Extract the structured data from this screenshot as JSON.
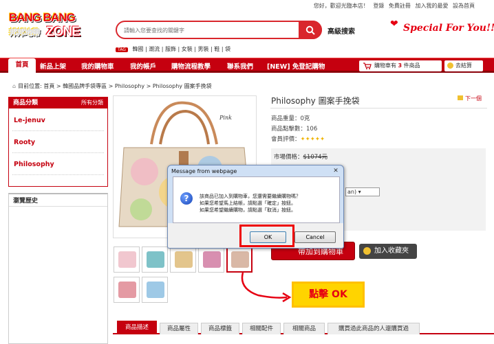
{
  "header": {
    "top_links": [
      "您好，歡迎光臨本店！",
      "登錄",
      "免費註冊",
      "加入我的最愛",
      "設為首頁"
    ],
    "logo_line1": "BANG BANG",
    "logo_line2": "ZONE",
    "logo_sub": "邦邦地帶",
    "search": {
      "placeholder": "請輸入您要查找的關鍵字"
    },
    "advanced_search": "高級搜索",
    "slogan": "Special For You!!",
    "tag_label": "TAG",
    "tags": "韓國 | 潮流 | 服飾 | 女裝 | 男裝 | 鞋 | 袋"
  },
  "nav": {
    "items": [
      "首頁",
      "新品上架",
      "我的購物車",
      "我的帳戶",
      "購物流程教學",
      "聯系我們",
      "[NEW] 免登記購物"
    ],
    "cart_text_pre": "購物車有",
    "cart_count": "3",
    "cart_text_post": "件商品",
    "checkout": "去結算"
  },
  "breadcrumb": "目前位置: 首頁 > 韓國品牌手袋專區 > Philosophy > Philosophy 圖案手挽袋",
  "sidebar": {
    "title": "商品分類",
    "all_link": "所有分類",
    "items": [
      "Le-jenuv",
      "Rooty",
      "Philosophy"
    ],
    "history_title": "瀏覽歷史"
  },
  "product": {
    "title": "Philosophy 圖案手挽袋",
    "next": "下一個",
    "weight": "商品重量：0克",
    "clicks": "商品點擊數：106",
    "rating_label": "會員評價：",
    "market_price_label": "市場價格：",
    "market_price": "$1074元",
    "image_label": "Pink",
    "buy_button": "帶加到購物車",
    "fav_button": "加入收藏夾"
  },
  "dialog": {
    "title": "Message from webpage",
    "close": "✕",
    "lines": [
      "該商品已加入到購物車，您還需要繼續購物嗎？",
      "如果您希望馬上結帳，請點選「確定」按鈕。",
      "如果您希望繼續購物，請點選「取消」按鈕。"
    ],
    "ok": "OK",
    "cancel": "Cancel"
  },
  "annotation": {
    "label": "點擊 OK",
    "color": "#e60012"
  },
  "tabs": [
    "商品描述",
    "商品屬性",
    "商品標籤",
    "相關配件",
    "相關商品",
    "購買過此商品的人還購買過"
  ],
  "colors": {
    "brand_red": "#c5000f",
    "highlight_yellow": "#ffd400"
  }
}
